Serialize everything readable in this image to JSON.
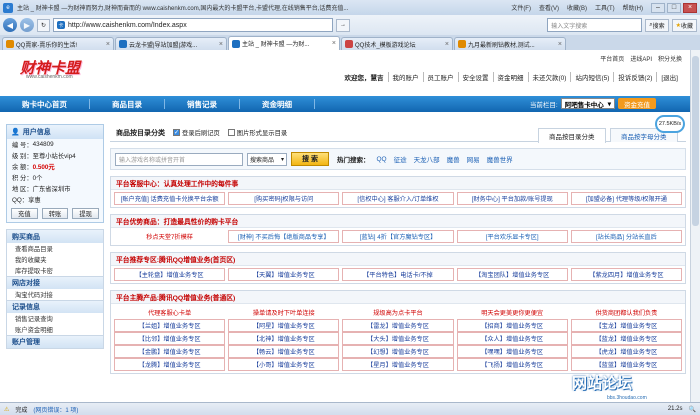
{
  "browser": {
    "title": "主站 _ 财神卡盟 —为财神而努力,财神而奋而的 www.caishenkm.com,国内最大的卡盟平台,卡盟代理,在线销售平台,话费充值...",
    "menu": [
      "文件(F)",
      "查看(V)",
      "收藏(B)",
      "工具(T)",
      "帮助(H)"
    ],
    "url": "http://www.caishenkm.com/Index.aspx",
    "search_placeholder": "输入文字搜索",
    "search_button": "搜索",
    "favorites": "收藏",
    "tabs": [
      {
        "label": "QQ賣家-賣乐你的生活!"
      },
      {
        "label": "云龙卡盟|导站加盟|游戏..."
      },
      {
        "label": "主站 _ 财神卡盟 —为财..."
      },
      {
        "label": "QQ技术_模板游戏论坛"
      },
      {
        "label": "九月最新刷钻教材,测试..."
      }
    ]
  },
  "site": {
    "logo_text": "财神卡盟",
    "logo_url": "www.caishenkm.com",
    "top_links": [
      "平台首页",
      "进线API",
      "积分兑换"
    ],
    "greeting": "欢迎您，慧吉",
    "top_nav": [
      "我的账户",
      "员工账户",
      "安全设置",
      "资金明细",
      "未还欠款(0)",
      "站内短信(5)",
      "投诉反馈(2)",
      "[退出]"
    ],
    "main_nav": [
      "购卡中心首页",
      "商品目录",
      "销售记录",
      "资金明细"
    ],
    "current_bar_label": "当前栏目:",
    "current_bar_value": "阿吧售卡中心",
    "recharge": "资金充值"
  },
  "user": {
    "header": "用户信息",
    "lines": [
      {
        "label": "编 号：",
        "value": "434809"
      },
      {
        "label": "级 别：",
        "value": "至尊小站长vip4"
      },
      {
        "label": "余 额：",
        "value": "0.500元"
      },
      {
        "label": "积 分：",
        "value": "0个"
      },
      {
        "label": "地 区：",
        "value": "广东省深圳市"
      },
      {
        "label": "QQ：",
        "value": "享惠"
      }
    ],
    "buttons": [
      "充值",
      "转账",
      "提现"
    ]
  },
  "sidebar": [
    {
      "title": "购买商品",
      "items": [
        "查看商品目录",
        "我的收藏夹",
        "库存提取卡密"
      ]
    },
    {
      "title": "网店对接",
      "items": [
        "淘宝代码对接"
      ]
    },
    {
      "title": "记录信息",
      "items": [
        "销售记录查询",
        "账户资金明细"
      ]
    },
    {
      "title": "账户管理",
      "items": []
    }
  ],
  "content": {
    "title": "商品按目录分类",
    "check1": "登录后刷记页",
    "check2": "图片形式显示目录",
    "tab_on": "商品按目录分类",
    "tab_off": "商品按字母分类",
    "search_placeholder": "输入游戏名称或拼音开首",
    "search_select": "搜索商品",
    "search_button": "搜 索",
    "hot_label": "热门搜索：",
    "hot_items": [
      "QQ",
      "征途",
      "天龙八部",
      "魔兽",
      "网易",
      "魔兽世界"
    ],
    "panels": [
      {
        "title": "平台客服中心：认真处理工作中的每件事",
        "rows": [
          [
            "[账户充值] 话费充值卡兑换平台余额",
            "[购买密码]权限与访问",
            "[信权中心] 客服介入/订单维权",
            "[财务中心] 平台加款/账号提现",
            "[加盟必备] 代理等级/权限开通"
          ]
        ]
      },
      {
        "title": "平台优势商品：打造最具性价的购卡平台",
        "rows": [
          [
            "秒点天堂7折模样",
            "[财神] 不买后悔【绝版商品专享】",
            "[蓝钻] 4折【官方魔钻专区】",
            "[平台欢乐显卡专区]",
            "[站长商品] 分站长直后"
          ]
        ]
      },
      {
        "title": "平台推荐专区:腾讯QQ增值业务(首页区)",
        "rows": [
          [
            "【主轮盘】增值业务专区",
            "【天翼】增值业务专区",
            "【平台特色】电话卡/不掉",
            "【淘宝团队】增值业务专区",
            "【紫龙四月】增值业务专区"
          ]
        ]
      },
      {
        "title": "平台主腾产品:腾讯QQ增值业务(普通区)",
        "rows": [
          [
            "代理客服心卡单",
            "操单请及时下叶单连接",
            "规级高为点卡平台",
            "明天会更美更你更便宜",
            "供货商团都认我们负责"
          ],
          [
            "【兰姐】增值业务专区",
            "【阿星】增值业务专区",
            "【雷龙】增值业务专区",
            "【招商】增值业务专区",
            "【宝龙】增值业务专区"
          ],
          [
            "【比邻】增值业务专区",
            "【北神】增值业务专区",
            "【大头】增值业务专区",
            "【众人】增值业务专区",
            "【蓝龙】增值业务专区"
          ],
          [
            "【金鹏】增值业务专区",
            "【畅云】增值业务专区",
            "【幻想】增值业务专区",
            "【嘿嘿】增值业务专区",
            "【虎龙】增值业务专区"
          ],
          [
            "【龙腾】增值业务专区",
            "【小哥】增值业务专区",
            "【星月】增值业务专区",
            "【飞扬】增值业务专区",
            "【蓝蓝】增值业务专区"
          ]
        ]
      }
    ]
  },
  "speed": "27.5KB/s",
  "status": {
    "left": "完成",
    "left2": "(网页错误：1 项)",
    "right": "21.2s"
  },
  "watermark": "网站论坛",
  "watermark_sub": "bbs.3houdao.com"
}
